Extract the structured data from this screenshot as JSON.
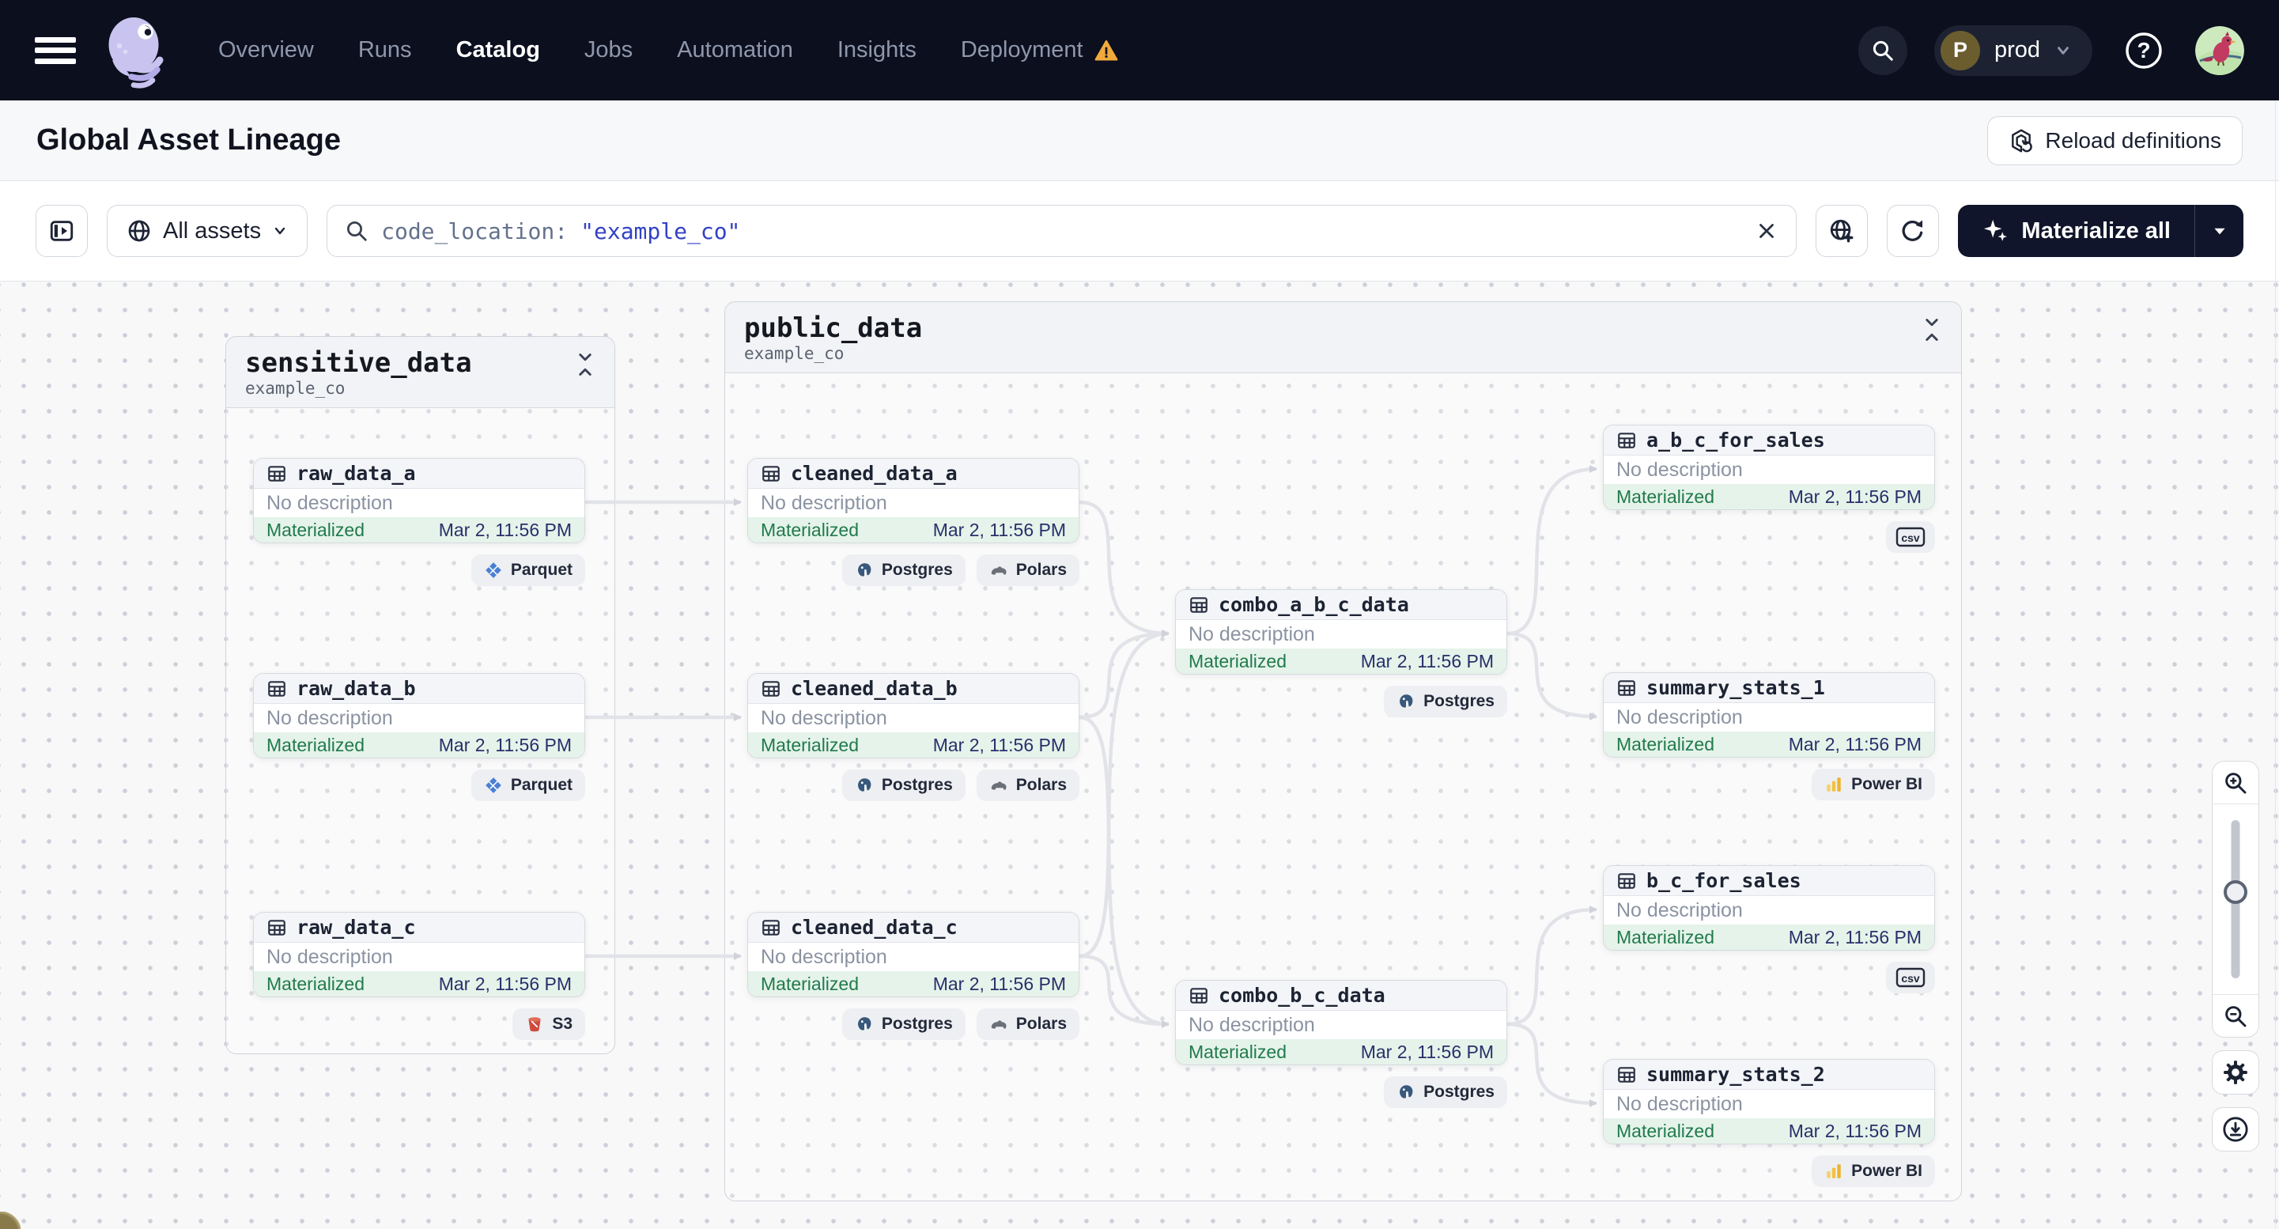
{
  "nav": {
    "items": [
      {
        "label": "Overview",
        "active": false,
        "warning": false
      },
      {
        "label": "Runs",
        "active": false,
        "warning": false
      },
      {
        "label": "Catalog",
        "active": true,
        "warning": false
      },
      {
        "label": "Jobs",
        "active": false,
        "warning": false
      },
      {
        "label": "Automation",
        "active": false,
        "warning": false
      },
      {
        "label": "Insights",
        "active": false,
        "warning": false
      },
      {
        "label": "Deployment",
        "active": false,
        "warning": true
      }
    ],
    "environment": {
      "initial": "P",
      "name": "prod"
    }
  },
  "header": {
    "title": "Global Asset Lineage",
    "reload_label": "Reload definitions"
  },
  "toolbar": {
    "scope_label": "All assets",
    "search_prefix": "code_location:",
    "search_value": "\"example_co\"",
    "materialize_label": "Materialize all"
  },
  "graph": {
    "groups": [
      {
        "id": "sensitive_data",
        "title": "sensitive_data",
        "subtitle": "example_co"
      },
      {
        "id": "public_data",
        "title": "public_data",
        "subtitle": "example_co"
      }
    ],
    "nodes": [
      {
        "id": "raw_data_a",
        "label": "raw_data_a",
        "description": "No description",
        "status": "Materialized",
        "timestamp": "Mar 2, 11:56 PM",
        "group": "sensitive_data",
        "tags": [
          {
            "label": "Parquet",
            "icon": "parquet-icon"
          }
        ]
      },
      {
        "id": "raw_data_b",
        "label": "raw_data_b",
        "description": "No description",
        "status": "Materialized",
        "timestamp": "Mar 2, 11:56 PM",
        "group": "sensitive_data",
        "tags": [
          {
            "label": "Parquet",
            "icon": "parquet-icon"
          }
        ]
      },
      {
        "id": "raw_data_c",
        "label": "raw_data_c",
        "description": "No description",
        "status": "Materialized",
        "timestamp": "Mar 2, 11:56 PM",
        "group": "sensitive_data",
        "tags": [
          {
            "label": "S3",
            "icon": "s3-icon"
          }
        ]
      },
      {
        "id": "cleaned_data_a",
        "label": "cleaned_data_a",
        "description": "No description",
        "status": "Materialized",
        "timestamp": "Mar 2, 11:56 PM",
        "group": "public_data",
        "tags": [
          {
            "label": "Postgres",
            "icon": "postgres-icon"
          },
          {
            "label": "Polars",
            "icon": "polars-icon"
          }
        ]
      },
      {
        "id": "cleaned_data_b",
        "label": "cleaned_data_b",
        "description": "No description",
        "status": "Materialized",
        "timestamp": "Mar 2, 11:56 PM",
        "group": "public_data",
        "tags": [
          {
            "label": "Postgres",
            "icon": "postgres-icon"
          },
          {
            "label": "Polars",
            "icon": "polars-icon"
          }
        ]
      },
      {
        "id": "cleaned_data_c",
        "label": "cleaned_data_c",
        "description": "No description",
        "status": "Materialized",
        "timestamp": "Mar 2, 11:56 PM",
        "group": "public_data",
        "tags": [
          {
            "label": "Postgres",
            "icon": "postgres-icon"
          },
          {
            "label": "Polars",
            "icon": "polars-icon"
          }
        ]
      },
      {
        "id": "combo_a_b_c_data",
        "label": "combo_a_b_c_data",
        "description": "No description",
        "status": "Materialized",
        "timestamp": "Mar 2, 11:56 PM",
        "group": "public_data",
        "tags": [
          {
            "label": "Postgres",
            "icon": "postgres-icon"
          }
        ]
      },
      {
        "id": "combo_b_c_data",
        "label": "combo_b_c_data",
        "description": "No description",
        "status": "Materialized",
        "timestamp": "Mar 2, 11:56 PM",
        "group": "public_data",
        "tags": [
          {
            "label": "Postgres",
            "icon": "postgres-icon"
          }
        ]
      },
      {
        "id": "a_b_c_for_sales",
        "label": "a_b_c_for_sales",
        "description": "No description",
        "status": "Materialized",
        "timestamp": "Mar 2, 11:56 PM",
        "group": "public_data",
        "tags": [
          {
            "label": "",
            "icon": "csv-icon"
          }
        ]
      },
      {
        "id": "summary_stats_1",
        "label": "summary_stats_1",
        "description": "No description",
        "status": "Materialized",
        "timestamp": "Mar 2, 11:56 PM",
        "group": "public_data",
        "tags": [
          {
            "label": "Power BI",
            "icon": "powerbi-icon"
          }
        ]
      },
      {
        "id": "b_c_for_sales",
        "label": "b_c_for_sales",
        "description": "No description",
        "status": "Materialized",
        "timestamp": "Mar 2, 11:56 PM",
        "group": "public_data",
        "tags": [
          {
            "label": "",
            "icon": "csv-icon"
          }
        ]
      },
      {
        "id": "summary_stats_2",
        "label": "summary_stats_2",
        "description": "No description",
        "status": "Materialized",
        "timestamp": "Mar 2, 11:56 PM",
        "group": "public_data",
        "tags": [
          {
            "label": "Power BI",
            "icon": "powerbi-icon"
          }
        ]
      }
    ],
    "edges": [
      [
        "raw_data_a",
        "cleaned_data_a"
      ],
      [
        "raw_data_b",
        "cleaned_data_b"
      ],
      [
        "raw_data_c",
        "cleaned_data_c"
      ],
      [
        "cleaned_data_a",
        "combo_a_b_c_data"
      ],
      [
        "cleaned_data_b",
        "combo_a_b_c_data"
      ],
      [
        "cleaned_data_c",
        "combo_a_b_c_data"
      ],
      [
        "cleaned_data_b",
        "combo_b_c_data"
      ],
      [
        "cleaned_data_c",
        "combo_b_c_data"
      ],
      [
        "combo_a_b_c_data",
        "a_b_c_for_sales"
      ],
      [
        "combo_a_b_c_data",
        "summary_stats_1"
      ],
      [
        "combo_b_c_data",
        "b_c_for_sales"
      ],
      [
        "combo_b_c_data",
        "summary_stats_2"
      ]
    ]
  },
  "colors": {
    "nav_bg": "#0b0f1e",
    "accent_dark": "#11152b",
    "materialized_text": "#217a4b",
    "materialized_bg": "#e5f3ea",
    "timestamp": "#28306b",
    "warning": "#f2a93c",
    "edge": "#e1e3e8",
    "search_value": "#3142c4"
  }
}
